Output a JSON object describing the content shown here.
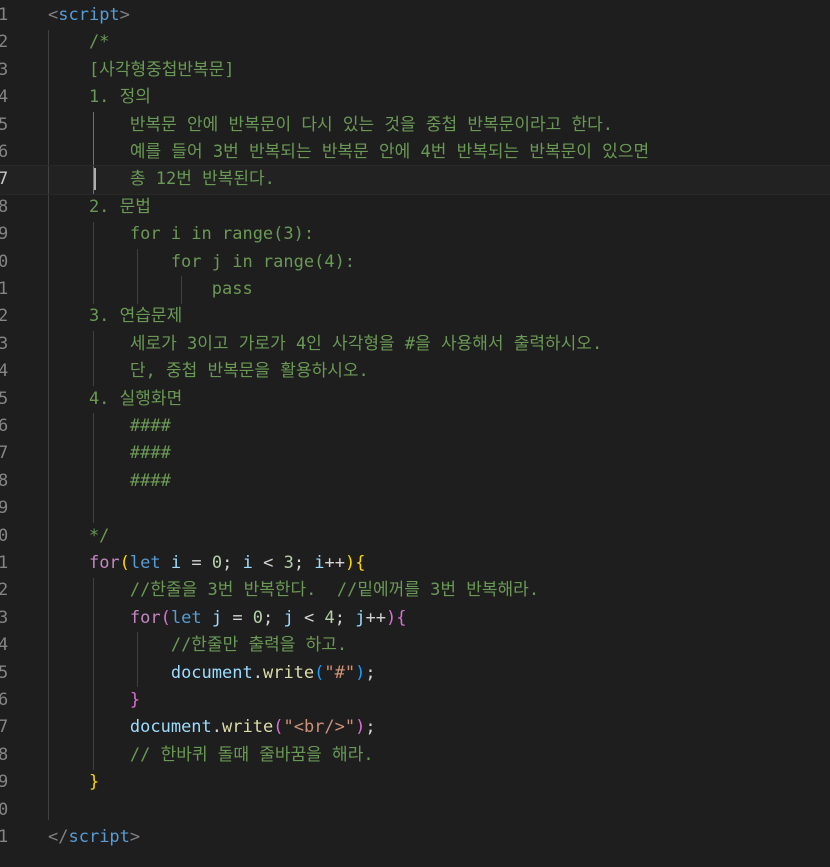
{
  "editor": {
    "line_numbers": [
      "1",
      "2",
      "3",
      "4",
      "5",
      "6",
      "7",
      "8",
      "9",
      "0",
      "1",
      "2",
      "3",
      "4",
      "5",
      "6",
      "7",
      "8",
      "9",
      "0",
      "1",
      "2",
      "3",
      "4",
      "5",
      "6",
      "7",
      "8",
      "9",
      "0",
      "1"
    ],
    "active_line_index": 6,
    "lines": [
      [
        {
          "c": "t-tag",
          "t": "<"
        },
        {
          "c": "t-tagname",
          "t": "script"
        },
        {
          "c": "t-tag",
          "t": ">"
        }
      ],
      [
        {
          "c": "t-comment",
          "t": "    /*"
        }
      ],
      [
        {
          "c": "t-comment",
          "t": "    [사각형중첩반복문]"
        }
      ],
      [
        {
          "c": "t-comment",
          "t": "    1. 정의"
        }
      ],
      [
        {
          "c": "t-comment",
          "t": "        반복문 안에 반복문이 다시 있는 것을 중첩 반복문이라고 한다."
        }
      ],
      [
        {
          "c": "t-comment",
          "t": "        예를 들어 3번 반복되는 반복문 안에 4번 반복되는 반복문이 있으면"
        }
      ],
      [
        {
          "c": "t-comment",
          "t": "        총 12번 반복된다."
        }
      ],
      [
        {
          "c": "t-comment",
          "t": "    2. 문법"
        }
      ],
      [
        {
          "c": "t-comment",
          "t": "        for i in range(3):"
        }
      ],
      [
        {
          "c": "t-comment",
          "t": "            for j in range(4):"
        }
      ],
      [
        {
          "c": "t-comment",
          "t": "                pass"
        }
      ],
      [
        {
          "c": "t-comment",
          "t": "    3. 연습문제"
        }
      ],
      [
        {
          "c": "t-comment",
          "t": "        세로가 3이고 가로가 4인 사각형을 #을 사용해서 출력하시오."
        }
      ],
      [
        {
          "c": "t-comment",
          "t": "        단, 중첩 반복문을 활용하시오."
        }
      ],
      [
        {
          "c": "t-comment",
          "t": "    4. 실행화면"
        }
      ],
      [
        {
          "c": "t-comment",
          "t": "        ####"
        }
      ],
      [
        {
          "c": "t-comment",
          "t": "        ####"
        }
      ],
      [
        {
          "c": "t-comment",
          "t": "        ####"
        }
      ],
      [
        {
          "c": "t-comment",
          "t": ""
        }
      ],
      [
        {
          "c": "t-comment",
          "t": "    */"
        }
      ],
      [
        {
          "c": "t-op",
          "t": "    "
        },
        {
          "c": "t-kw",
          "t": "for"
        },
        {
          "c": "t-b1",
          "t": "("
        },
        {
          "c": "t-let",
          "t": "let"
        },
        {
          "c": "t-op",
          "t": " "
        },
        {
          "c": "t-var",
          "t": "i"
        },
        {
          "c": "t-op",
          "t": " = "
        },
        {
          "c": "t-num",
          "t": "0"
        },
        {
          "c": "t-op",
          "t": "; "
        },
        {
          "c": "t-var",
          "t": "i"
        },
        {
          "c": "t-op",
          "t": " < "
        },
        {
          "c": "t-num",
          "t": "3"
        },
        {
          "c": "t-op",
          "t": "; "
        },
        {
          "c": "t-var",
          "t": "i"
        },
        {
          "c": "t-op",
          "t": "++"
        },
        {
          "c": "t-b1",
          "t": ")"
        },
        {
          "c": "t-b1",
          "t": "{"
        }
      ],
      [
        {
          "c": "t-op",
          "t": "        "
        },
        {
          "c": "t-comment",
          "t": "//한줄을 3번 반복한다.  //밑에꺼를 3번 반복해라."
        }
      ],
      [
        {
          "c": "t-op",
          "t": "        "
        },
        {
          "c": "t-kw",
          "t": "for"
        },
        {
          "c": "t-b2",
          "t": "("
        },
        {
          "c": "t-let",
          "t": "let"
        },
        {
          "c": "t-op",
          "t": " "
        },
        {
          "c": "t-var",
          "t": "j"
        },
        {
          "c": "t-op",
          "t": " = "
        },
        {
          "c": "t-num",
          "t": "0"
        },
        {
          "c": "t-op",
          "t": "; "
        },
        {
          "c": "t-var",
          "t": "j"
        },
        {
          "c": "t-op",
          "t": " < "
        },
        {
          "c": "t-num",
          "t": "4"
        },
        {
          "c": "t-op",
          "t": "; "
        },
        {
          "c": "t-var",
          "t": "j"
        },
        {
          "c": "t-op",
          "t": "++"
        },
        {
          "c": "t-b2",
          "t": ")"
        },
        {
          "c": "t-b2",
          "t": "{"
        }
      ],
      [
        {
          "c": "t-op",
          "t": "            "
        },
        {
          "c": "t-comment",
          "t": "//한줄만 출력을 하고."
        }
      ],
      [
        {
          "c": "t-op",
          "t": "            "
        },
        {
          "c": "t-obj",
          "t": "document"
        },
        {
          "c": "t-op",
          "t": "."
        },
        {
          "c": "t-fn",
          "t": "write"
        },
        {
          "c": "t-b3",
          "t": "("
        },
        {
          "c": "t-str",
          "t": "\"#\""
        },
        {
          "c": "t-b3",
          "t": ")"
        },
        {
          "c": "t-op",
          "t": ";"
        }
      ],
      [
        {
          "c": "t-op",
          "t": "        "
        },
        {
          "c": "t-b2",
          "t": "}"
        }
      ],
      [
        {
          "c": "t-op",
          "t": "        "
        },
        {
          "c": "t-obj",
          "t": "document"
        },
        {
          "c": "t-op",
          "t": "."
        },
        {
          "c": "t-fn",
          "t": "write"
        },
        {
          "c": "t-b2",
          "t": "("
        },
        {
          "c": "t-str",
          "t": "\"<br/>\""
        },
        {
          "c": "t-b2",
          "t": ")"
        },
        {
          "c": "t-op",
          "t": ";"
        }
      ],
      [
        {
          "c": "t-op",
          "t": "        "
        },
        {
          "c": "t-comment",
          "t": "// 한바퀴 돌때 줄바꿈을 해라."
        }
      ],
      [
        {
          "c": "t-op",
          "t": "    "
        },
        {
          "c": "t-b1",
          "t": "}"
        }
      ],
      [],
      [
        {
          "c": "t-tag",
          "t": "</"
        },
        {
          "c": "t-tagname",
          "t": "script"
        },
        {
          "c": "t-tag",
          "t": ">"
        }
      ]
    ]
  }
}
